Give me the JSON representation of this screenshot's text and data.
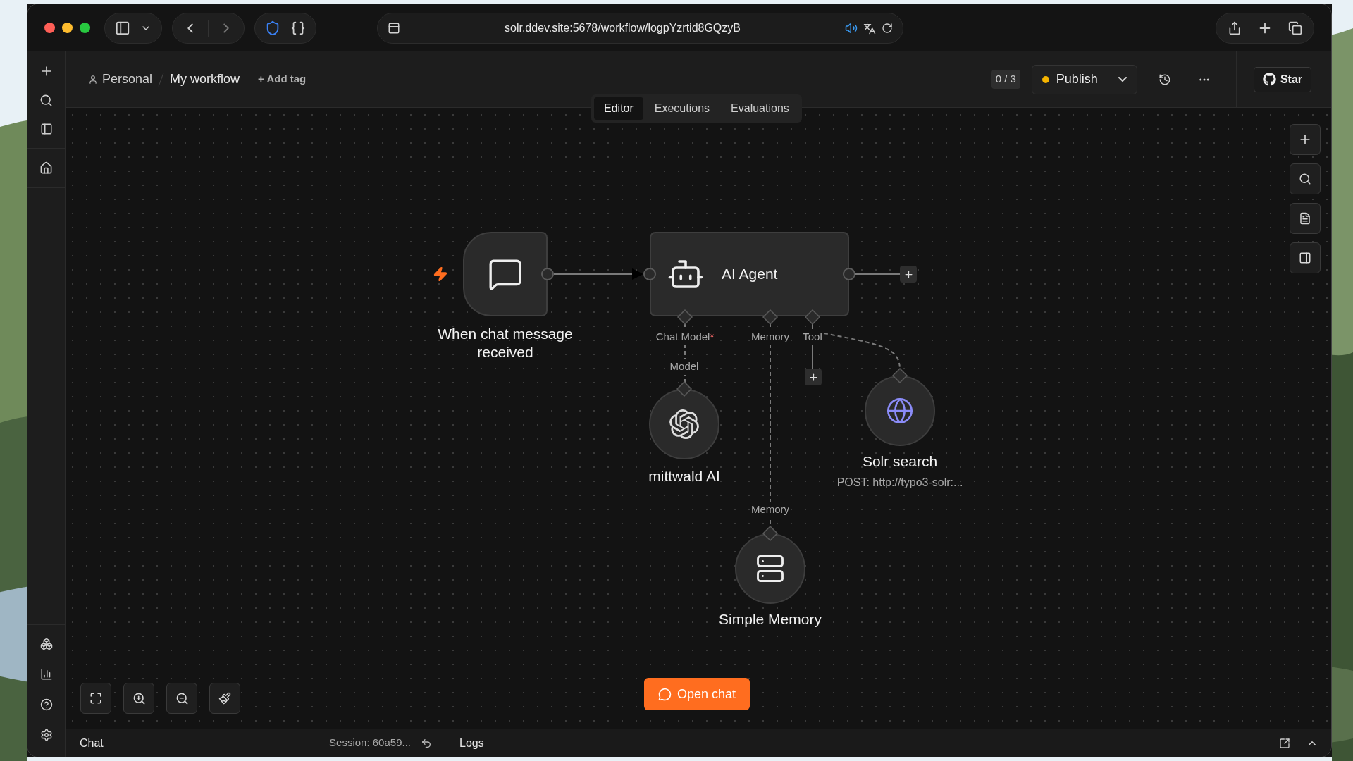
{
  "browser": {
    "url": "solr.ddev.site:5678/workflow/logpYzrtid8GQzyB"
  },
  "breadcrumb": {
    "project": "Personal",
    "workflow": "My workflow",
    "add_tag": "+ Add tag"
  },
  "view_tabs": [
    {
      "label": "Editor",
      "selected": true
    },
    {
      "label": "Executions",
      "selected": false
    },
    {
      "label": "Evaluations",
      "selected": false
    }
  ],
  "toolbar": {
    "counter": "0 / 3",
    "publish": "Publish",
    "star": "Star"
  },
  "nodes": [
    {
      "kind": "trigger",
      "label": "When chat message received"
    },
    {
      "kind": "agent",
      "label": "AI Agent",
      "ports": [
        {
          "label": "Chat Model",
          "required_mark": "*"
        },
        {
          "label": "Memory"
        },
        {
          "label": "Tool"
        }
      ]
    },
    {
      "kind": "model",
      "label": "mittwald AI",
      "port": "Model"
    },
    {
      "kind": "tool",
      "label": "Solr search",
      "subtitle": "POST: http://typo3-solr:..."
    },
    {
      "kind": "memory",
      "label": "Simple Memory",
      "port": "Memory"
    }
  ],
  "open_chat": "Open chat",
  "bottom_panel": {
    "chat": "Chat",
    "session": "Session: 60a59...",
    "logs": "Logs"
  }
}
